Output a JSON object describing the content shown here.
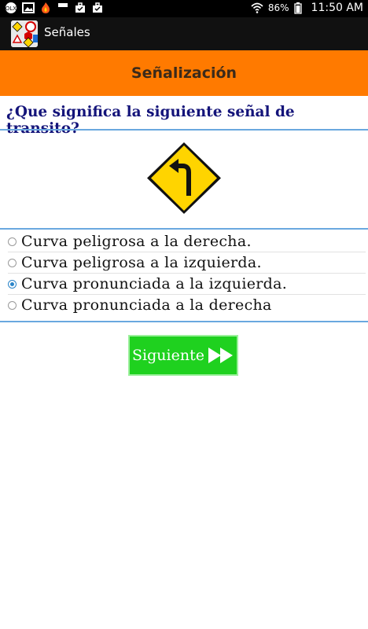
{
  "status_bar": {
    "battery": "86%",
    "time": "11:50 AM",
    "icons": [
      "olx-icon",
      "image-icon",
      "fire-icon",
      "flipboard-icon",
      "briefcase-icon",
      "briefcase-icon",
      "wifi-icon",
      "signal-icon",
      "battery-icon"
    ]
  },
  "action_bar": {
    "title": "Señales",
    "icon": "app-icon"
  },
  "header": {
    "title": "Señalización",
    "color": "#ff7a00"
  },
  "question": {
    "text": "¿Que significa la siguiente señal de transito?"
  },
  "sign": {
    "icon": "left-curve-sign-icon",
    "color": "#ffd400"
  },
  "options": [
    {
      "label": "Curva peligrosa a la derecha.",
      "checked": false
    },
    {
      "label": "Curva peligrosa a la izquierda.",
      "checked": false
    },
    {
      "label": "Curva pronunciada a la izquierda.",
      "checked": true
    },
    {
      "label": "Curva pronunciada a la derecha",
      "checked": false
    }
  ],
  "next_button": {
    "label": "Siguiente",
    "icon": "fast-forward-icon",
    "color": "#1fd11f"
  }
}
